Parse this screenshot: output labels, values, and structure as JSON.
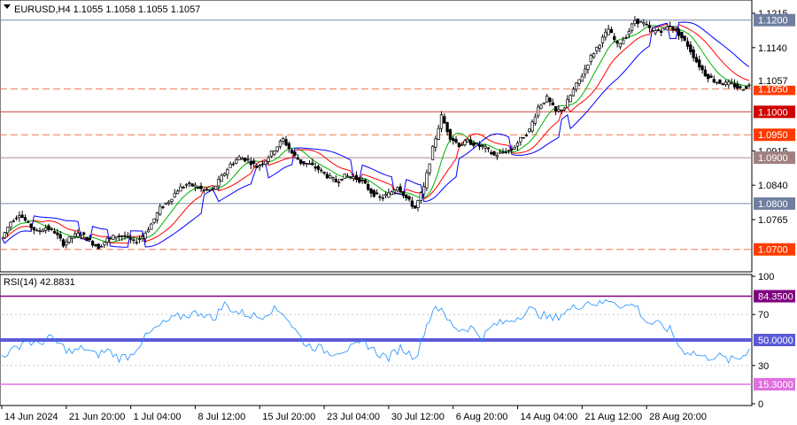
{
  "header": {
    "symbol_line": "EURUSD,H4  1.1055 1.1058 1.1055 1.1057"
  },
  "chart_data": {
    "type": "candlestick",
    "symbol": "EURUSD",
    "timeframe": "H4",
    "ohlc_readout": [
      1.1055,
      1.1058,
      1.1055,
      1.1057
    ],
    "price_axis": {
      "range": [
        1.0655,
        1.124
      ],
      "ticks": [
        "1.1215",
        "1.1140",
        "1.0915",
        "1.0840",
        "1.0765"
      ],
      "tick_values": [
        1.1215,
        1.114,
        1.0915,
        1.084,
        1.0765
      ]
    },
    "current_price": {
      "value": 1.1057,
      "label": "1.1057",
      "color": "#000000"
    },
    "levels": [
      {
        "value": 1.12,
        "label": "1.1200",
        "style": "solid",
        "line_color": "#7a8aa8",
        "tag_color": "#6f7fa0"
      },
      {
        "value": 1.105,
        "label": "1.1050",
        "style": "dashed",
        "line_color": "#f07a4a",
        "tag_color": "#ff3c00"
      },
      {
        "value": 1.1,
        "label": "1.1000",
        "style": "solid",
        "line_color": "#d04040",
        "tag_color": "#d00000"
      },
      {
        "value": 1.095,
        "label": "1.0950",
        "style": "dashed",
        "line_color": "#f07a4a",
        "tag_color": "#ff3c00"
      },
      {
        "value": 1.09,
        "label": "1.0900",
        "style": "solid",
        "line_color": "#b08a8a",
        "tag_color": "#a08080"
      },
      {
        "value": 1.08,
        "label": "1.0800",
        "style": "solid",
        "line_color": "#7a8aa8",
        "tag_color": "#6f7fa0"
      },
      {
        "value": 1.07,
        "label": "1.0700",
        "style": "dashed",
        "line_color": "#f07a4a",
        "tag_color": "#ff3c00"
      }
    ],
    "close_path": [
      [
        0,
        1.0725
      ],
      [
        3,
        1.076
      ],
      [
        6,
        1.0778
      ],
      [
        9,
        1.0755
      ],
      [
        12,
        1.0738
      ],
      [
        15,
        1.0748
      ],
      [
        18,
        1.0738
      ],
      [
        21,
        1.0712
      ],
      [
        24,
        1.0728
      ],
      [
        27,
        1.0735
      ],
      [
        30,
        1.0718
      ],
      [
        33,
        1.0705
      ],
      [
        36,
        1.0722
      ],
      [
        39,
        1.073
      ],
      [
        42,
        1.0728
      ],
      [
        45,
        1.0716
      ],
      [
        48,
        1.0728
      ],
      [
        51,
        1.0755
      ],
      [
        54,
        1.079
      ],
      [
        57,
        1.0806
      ],
      [
        60,
        1.083
      ],
      [
        63,
        1.0842
      ],
      [
        66,
        1.0838
      ],
      [
        69,
        1.0828
      ],
      [
        72,
        1.083
      ],
      [
        75,
        1.0858
      ],
      [
        78,
        1.0885
      ],
      [
        81,
        1.09
      ],
      [
        84,
        1.0895
      ],
      [
        87,
        1.088
      ],
      [
        90,
        1.0895
      ],
      [
        93,
        1.0918
      ],
      [
        96,
        1.094
      ],
      [
        99,
        1.091
      ],
      [
        102,
        1.089
      ],
      [
        105,
        1.0885
      ],
      [
        108,
        1.0875
      ],
      [
        111,
        1.086
      ],
      [
        114,
        1.0848
      ],
      [
        117,
        1.086
      ],
      [
        120,
        1.0858
      ],
      [
        123,
        1.0848
      ],
      [
        126,
        1.0825
      ],
      [
        129,
        1.0812
      ],
      [
        132,
        1.082
      ],
      [
        135,
        1.0838
      ],
      [
        138,
        1.0812
      ],
      [
        141,
        1.079
      ],
      [
        144,
        1.0835
      ],
      [
        147,
        1.092
      ],
      [
        150,
        1.099
      ],
      [
        153,
        1.0945
      ],
      [
        156,
        1.0928
      ],
      [
        159,
        1.0935
      ],
      [
        162,
        1.0928
      ],
      [
        165,
        1.092
      ],
      [
        168,
        1.0905
      ],
      [
        171,
        1.0912
      ],
      [
        174,
        1.0918
      ],
      [
        177,
        1.094
      ],
      [
        180,
        1.096
      ],
      [
        183,
        1.101
      ],
      [
        186,
        1.103
      ],
      [
        189,
        1.1
      ],
      [
        192,
        1.101
      ],
      [
        195,
        1.1048
      ],
      [
        198,
        1.108
      ],
      [
        201,
        1.112
      ],
      [
        204,
        1.115
      ],
      [
        207,
        1.118
      ],
      [
        210,
        1.1145
      ],
      [
        213,
        1.1165
      ],
      [
        216,
        1.12
      ],
      [
        219,
        1.1192
      ],
      [
        222,
        1.1175
      ],
      [
        225,
        1.1178
      ],
      [
        228,
        1.1188
      ],
      [
        231,
        1.117
      ],
      [
        234,
        1.1145
      ],
      [
        237,
        1.111
      ],
      [
        240,
        1.1082
      ],
      [
        243,
        1.1068
      ],
      [
        246,
        1.1062
      ],
      [
        249,
        1.106
      ],
      [
        252,
        1.105
      ],
      [
        255,
        1.1057
      ]
    ],
    "moving_averages": [
      {
        "color": "#00b000",
        "lag": 4
      },
      {
        "color": "#ff0000",
        "lag": 7
      },
      {
        "color": "#0000ff",
        "lag": 11
      }
    ],
    "time_axis": {
      "labels": [
        "14 Jun 2024",
        "21 Jun 20:00",
        "1 Jul 04:00",
        "8 Jul 12:00",
        "15 Jul 20:00",
        "23 Jul 04:00",
        "30 Jul 12:00",
        "6 Aug 20:00",
        "14 Aug 04:00",
        "21 Aug 12:00",
        "28 Aug 20:00"
      ],
      "positions": [
        0,
        22,
        44,
        66,
        88,
        110,
        132,
        154,
        176,
        198,
        220
      ]
    },
    "rsi": {
      "title": "RSI(14) 42.8831",
      "period": 14,
      "value": 42.8831,
      "range": [
        0,
        100
      ],
      "ticks": [
        "100",
        "70",
        "30",
        "0"
      ],
      "tick_values": [
        100,
        70,
        30,
        0
      ],
      "levels": [
        {
          "value": 84.35,
          "label": "84.3500",
          "color": "#800080"
        },
        {
          "value": 50,
          "label": "50.0000",
          "color": "#5a5ad8"
        },
        {
          "value": 15.3,
          "label": "15.3000",
          "color": "#e070e0"
        }
      ],
      "line_color": "#1e90ff",
      "points": [
        [
          0,
          38
        ],
        [
          4,
          42
        ],
        [
          8,
          50
        ],
        [
          12,
          46
        ],
        [
          16,
          52
        ],
        [
          20,
          46
        ],
        [
          24,
          40
        ],
        [
          28,
          44
        ],
        [
          32,
          38
        ],
        [
          36,
          42
        ],
        [
          40,
          36
        ],
        [
          44,
          38
        ],
        [
          48,
          50
        ],
        [
          52,
          58
        ],
        [
          56,
          64
        ],
        [
          60,
          68
        ],
        [
          64,
          70
        ],
        [
          68,
          72
        ],
        [
          72,
          66
        ],
        [
          76,
          78
        ],
        [
          80,
          72
        ],
        [
          84,
          70
        ],
        [
          88,
          68
        ],
        [
          92,
          74
        ],
        [
          96,
          72
        ],
        [
          100,
          58
        ],
        [
          104,
          46
        ],
        [
          108,
          44
        ],
        [
          112,
          40
        ],
        [
          116,
          42
        ],
        [
          120,
          44
        ],
        [
          124,
          48
        ],
        [
          128,
          40
        ],
        [
          132,
          36
        ],
        [
          136,
          44
        ],
        [
          140,
          38
        ],
        [
          142,
          40
        ],
        [
          144,
          56
        ],
        [
          148,
          78
        ],
        [
          152,
          66
        ],
        [
          156,
          58
        ],
        [
          160,
          60
        ],
        [
          164,
          52
        ],
        [
          168,
          62
        ],
        [
          172,
          64
        ],
        [
          176,
          68
        ],
        [
          180,
          74
        ],
        [
          184,
          70
        ],
        [
          188,
          66
        ],
        [
          192,
          72
        ],
        [
          196,
          76
        ],
        [
          200,
          80
        ],
        [
          204,
          78
        ],
        [
          208,
          82
        ],
        [
          212,
          76
        ],
        [
          216,
          78
        ],
        [
          220,
          64
        ],
        [
          224,
          62
        ],
        [
          228,
          58
        ],
        [
          232,
          42
        ],
        [
          236,
          40
        ],
        [
          240,
          36
        ],
        [
          244,
          38
        ],
        [
          248,
          34
        ],
        [
          252,
          36
        ],
        [
          255,
          43
        ]
      ]
    }
  }
}
